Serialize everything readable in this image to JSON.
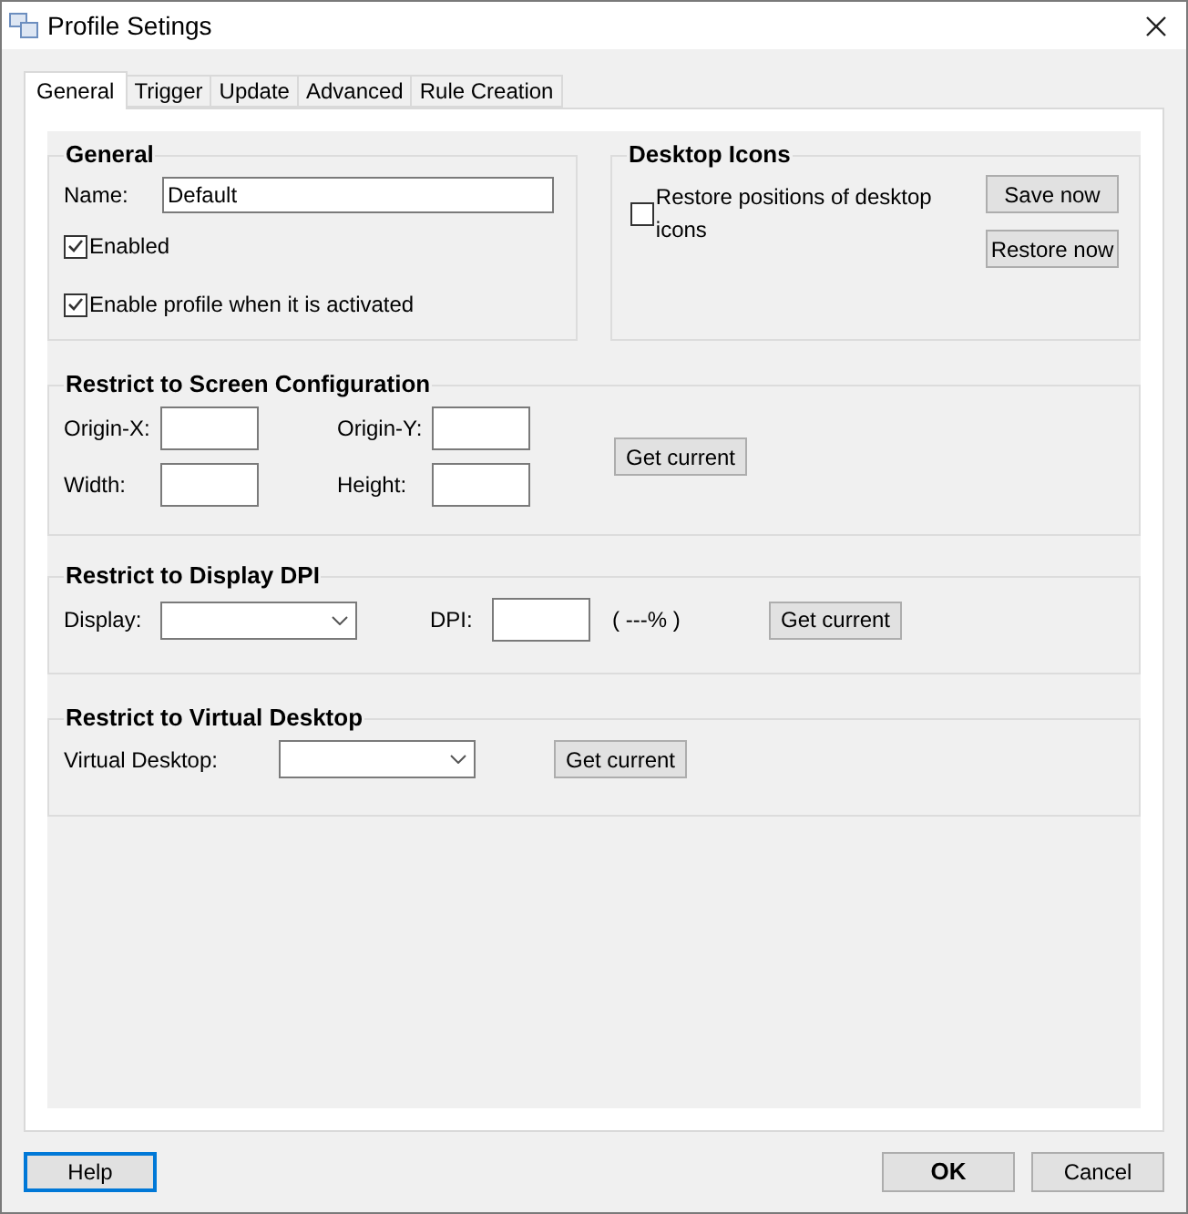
{
  "window": {
    "title": "Profile Setings"
  },
  "tabs": [
    {
      "label": "General",
      "selected": true
    },
    {
      "label": "Trigger",
      "selected": false
    },
    {
      "label": "Update",
      "selected": false
    },
    {
      "label": "Advanced",
      "selected": false
    },
    {
      "label": "Rule Creation",
      "selected": false
    }
  ],
  "general": {
    "title": "General",
    "name_label": "Name:",
    "name_value": "Default",
    "checkboxes": [
      {
        "label": "Enabled",
        "checked": true
      },
      {
        "label": "Enable profile when it is activated",
        "checked": true
      }
    ]
  },
  "desktop_icons": {
    "title": "Desktop Icons",
    "checkbox": {
      "label": "Restore positions of desktop icons",
      "checked": false
    },
    "buttons": [
      "Save now",
      "Restore now"
    ]
  },
  "screen_config": {
    "title": "Restrict to Screen Configuration",
    "fields": [
      {
        "label": "Origin-X:"
      },
      {
        "label": "Origin-Y:"
      },
      {
        "label": "Width:"
      },
      {
        "label": "Height:"
      }
    ],
    "button": "Get current"
  },
  "display_dpi": {
    "title": "Restrict to Display DPI",
    "display_label": "Display:",
    "dpi_label": "DPI:",
    "percent": "( ---% )",
    "button": "Get current"
  },
  "virtual_desktop": {
    "title": "Restrict to Virtual Desktop",
    "label": "Virtual Desktop:",
    "button": "Get current"
  },
  "footer": [
    {
      "label": "Help",
      "kind": "focused"
    },
    {
      "label": "OK",
      "kind": "default"
    },
    {
      "label": "Cancel",
      "kind": "normal"
    }
  ]
}
